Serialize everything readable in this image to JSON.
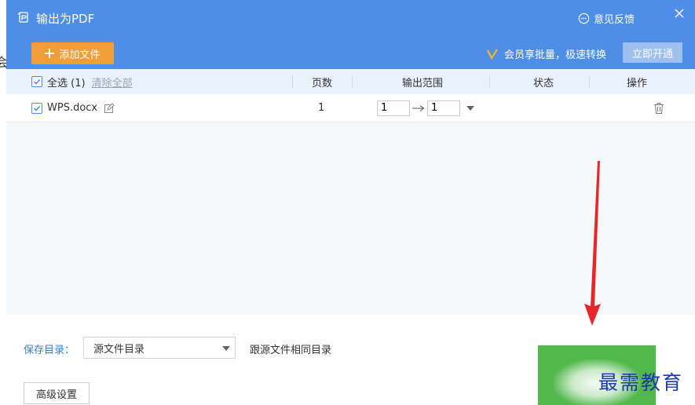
{
  "window": {
    "title": "输出为PDF",
    "feedback_label": "意见反馈"
  },
  "toolbar": {
    "add_file_label": "添加文件",
    "member_text": "会员享批量，极速转换",
    "open_membership_label": "立即开通"
  },
  "table": {
    "select_all_label": "全选 (1)",
    "clear_all_label": "清除全部",
    "columns": [
      "页数",
      "输出范围",
      "状态",
      "操作"
    ],
    "rows": [
      {
        "filename": "WPS.docx",
        "pages": "1",
        "range_from": "1",
        "range_to": "1",
        "status": ""
      }
    ]
  },
  "footer": {
    "save_dir_label": "保存目录：",
    "save_dir_value": "源文件目录",
    "save_dir_hint": "跟源文件相同目录",
    "advanced_label": "高级设置"
  },
  "watermark": "最需教育",
  "colors": {
    "header": "#4f8ee6",
    "add_button": "#f19d38",
    "accent": "#3b78d4",
    "start_button": "#53b84c",
    "arrow": "#e8262a"
  }
}
